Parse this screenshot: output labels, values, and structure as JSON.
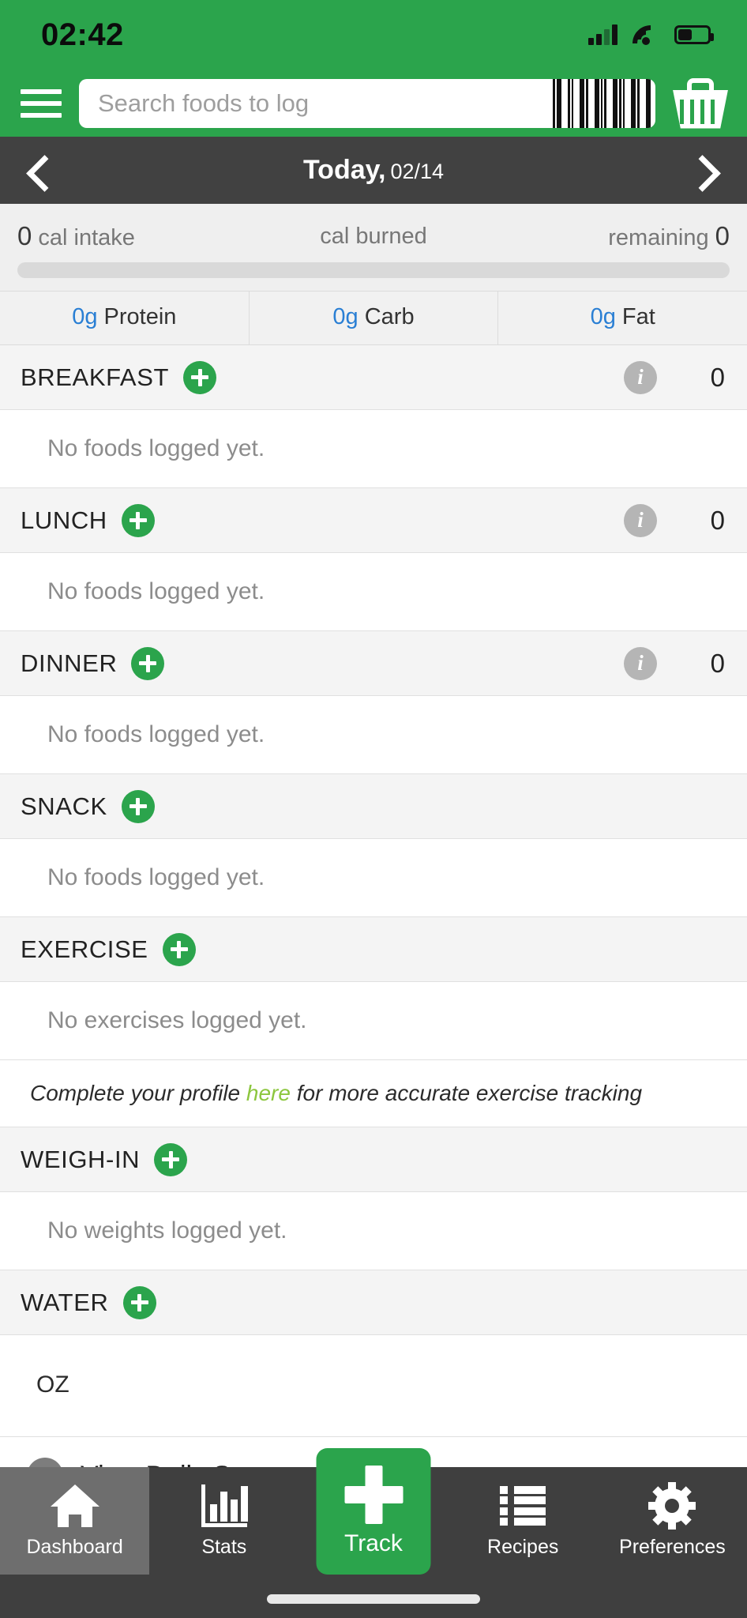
{
  "status_bar": {
    "time": "02:42",
    "signal_icon": "signal-bars-icon",
    "wifi_icon": "wifi-icon",
    "battery_icon": "battery-icon"
  },
  "header": {
    "menu_icon": "hamburger-menu-icon",
    "search_placeholder": "Search foods to log",
    "barcode_icon": "barcode-scan-icon",
    "basket_icon": "shopping-basket-icon"
  },
  "date_nav": {
    "prev_icon": "chevron-left-icon",
    "next_icon": "chevron-right-icon",
    "label": "Today,",
    "date": "02/14"
  },
  "calorie_summary": {
    "intake_value": "0",
    "intake_label": "cal intake",
    "burned_label": "cal burned",
    "remaining_label": "remaining",
    "remaining_value": "0",
    "progress_percent": 0
  },
  "macros": [
    {
      "value": "0g",
      "label": "Protein",
      "color": "#2a7fd4"
    },
    {
      "value": "0g",
      "label": "Carb",
      "color": "#2a7fd4"
    },
    {
      "value": "0g",
      "label": "Fat",
      "color": "#2a7fd4"
    }
  ],
  "sections": [
    {
      "title": "BREAKFAST",
      "has_info": true,
      "count": "0",
      "empty_text": "No foods logged yet."
    },
    {
      "title": "LUNCH",
      "has_info": true,
      "count": "0",
      "empty_text": "No foods logged yet."
    },
    {
      "title": "DINNER",
      "has_info": true,
      "count": "0",
      "empty_text": "No foods logged yet."
    },
    {
      "title": "SNACK",
      "has_info": false,
      "count": "",
      "empty_text": "No foods logged yet."
    },
    {
      "title": "EXERCISE",
      "has_info": false,
      "count": "",
      "empty_text": "No exercises logged yet."
    },
    {
      "title": "WEIGH-IN",
      "has_info": false,
      "count": "",
      "empty_text": "No weights logged yet."
    },
    {
      "title": "WATER",
      "has_info": false,
      "count": "",
      "empty_text": "OZ"
    }
  ],
  "profile_note": {
    "before": "Complete your profile ",
    "link": "here",
    "after": " for more accurate exercise tracking"
  },
  "summary_link": {
    "icon": "pie-chart-icon",
    "label": "View Daily Summary"
  },
  "tabbar": {
    "items": [
      {
        "label": "Dashboard",
        "icon": "home-icon",
        "active": true
      },
      {
        "label": "Stats",
        "icon": "bar-chart-icon",
        "active": false
      },
      {
        "label": "Recipes",
        "icon": "list-icon",
        "active": false
      },
      {
        "label": "Preferences",
        "icon": "gear-icon",
        "active": false
      }
    ],
    "track": {
      "label": "Track",
      "icon": "plus-icon"
    }
  },
  "colors": {
    "brand_green": "#2ba44c",
    "dark_bar": "#414141",
    "tabbar": "#3f3f3f",
    "macro_blue": "#2a7fd4",
    "link_green": "#8cc63e"
  }
}
